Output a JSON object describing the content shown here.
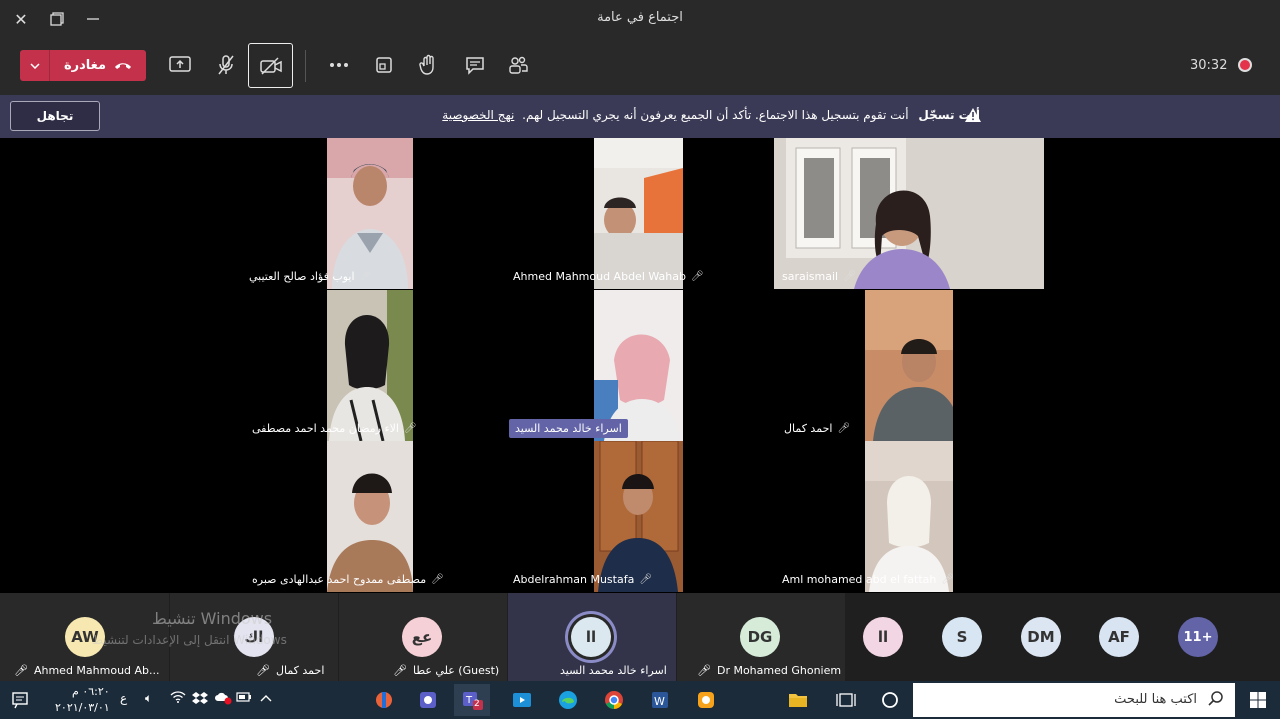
{
  "window": {
    "title": "اجتماع في عامة"
  },
  "toolbar": {
    "leave_label": "مغادرة",
    "timer": "30:32"
  },
  "banner": {
    "dismiss_label": "تجاهل",
    "recording_title": "أنت تسجّل",
    "message": "أنت تقوم بتسجيل هذا الاجتماع. تأكد أن الجميع يعرفون أنه يجري التسجيل لهم.",
    "policy_link": "نهج الخصوصية"
  },
  "videos": [
    {
      "name": "ايوب فؤاد صالح العتيبي"
    },
    {
      "name": "Ahmed Mahmoud Abdel Wahab"
    },
    {
      "name": "saraismail"
    },
    {
      "name": "الاء رمضان محمد احمد مصطفى"
    },
    {
      "name": "اسراء خالد محمد السيد"
    },
    {
      "name": "احمد كمال"
    },
    {
      "name": "مصطفى ممدوح احمد عبدالهادى صبره"
    },
    {
      "name": "Abdelrahman Mustafa"
    },
    {
      "name": "Aml mohamed abd el fattah"
    }
  ],
  "participants": [
    {
      "initials": "AW",
      "name": "Ahmed Mahmoud Ab...",
      "color": "#f6e8b0"
    },
    {
      "initials": "اك",
      "name": "احمد كمال",
      "color": "#e4e4f0"
    },
    {
      "initials": "عع",
      "name": "علي عطا (Guest)",
      "color": "#f5d0d6"
    },
    {
      "initials": "اا",
      "name": "اسراء خالد محمد السيد",
      "color": "#dbe8f0"
    },
    {
      "initials": "DG",
      "name": "Dr Mohamed Ghoniem",
      "color": "#d6ecd9"
    }
  ],
  "overflow_avatars": [
    {
      "initials": "اا",
      "color": "#f3d6e3"
    },
    {
      "initials": "S",
      "color": "#d8e6f3"
    },
    {
      "initials": "DM",
      "color": "#dbe6f2"
    },
    {
      "initials": "AF",
      "color": "#d9e4f2"
    },
    {
      "initials": "11+",
      "color": "#6264a7"
    }
  ],
  "watermark": {
    "line1": "تنشيط Windows",
    "line2": "انتقل إلى الإعدادات لتنشيط Windows"
  },
  "taskbar": {
    "search_placeholder": "اكتب هنا للبحث",
    "time": "٠٦:٢٠ م",
    "date": "٢٠٢١/٠٣/٠١",
    "lang": "ع",
    "teams_badge": "2"
  }
}
